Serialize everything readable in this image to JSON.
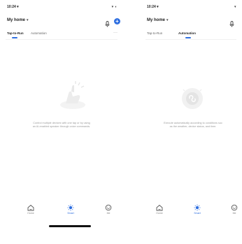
{
  "left": {
    "status_time": "10:24 ▾",
    "status_icons": "▾ ◐",
    "home_label": "My home",
    "home_chevron": "▾",
    "tabs": [
      {
        "label": "Tap-to-Run",
        "active": true
      },
      {
        "label": "Automation",
        "active": false
      }
    ],
    "more": "···",
    "empty_text_line1": "Control multiple devices with one tap or by using",
    "empty_text_line2": "an AI-enabled speaker through voice commands.",
    "nav": [
      {
        "label": "Home",
        "icon": "home-icon",
        "active": false
      },
      {
        "label": "Smart",
        "icon": "sun-icon",
        "active": true
      },
      {
        "label": "Me",
        "icon": "smile-icon",
        "active": false
      }
    ]
  },
  "right": {
    "status_time": "10:24 ▾",
    "status_icons": "▾",
    "home_label": "My home",
    "home_chevron": "▾",
    "tabs": [
      {
        "label": "Tap-to-Run",
        "active": false
      },
      {
        "label": "Automation",
        "active": true
      }
    ],
    "empty_text_line1": "Execute automatically according to conditions suc",
    "empty_text_line2": "as the weather, device status, and time.",
    "nav": [
      {
        "label": "Home",
        "icon": "home-icon",
        "active": false
      },
      {
        "label": "Smart",
        "icon": "sun-icon",
        "active": true
      },
      {
        "label": "Me",
        "icon": "smile-icon",
        "active": false
      }
    ]
  },
  "colors": {
    "accent": "#2f6fe0",
    "muted_text": "#9a9a9a"
  }
}
